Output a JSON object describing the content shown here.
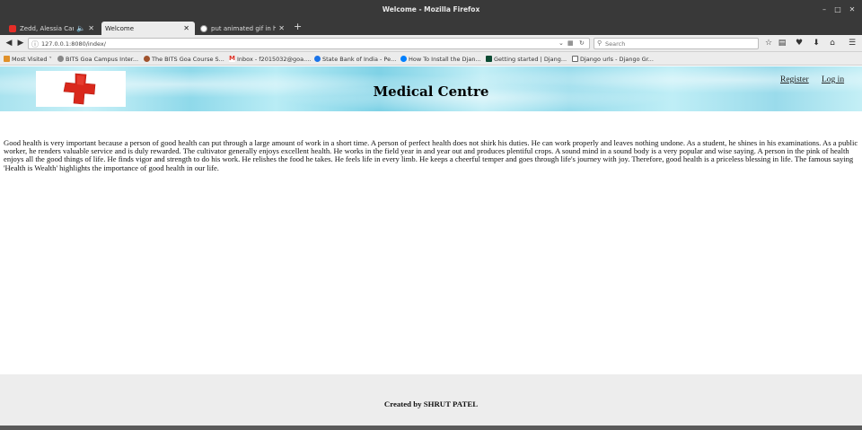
{
  "window": {
    "title": "Welcome - Mozilla Firefox",
    "controls": [
      "minimize",
      "maximize",
      "close"
    ]
  },
  "tabs": [
    {
      "label": "Zedd, Alessia Cara -",
      "icon": "youtube-icon",
      "audio": true,
      "active": false
    },
    {
      "label": "Welcome",
      "icon": "",
      "active": true
    },
    {
      "label": "put animated gif in html",
      "icon": "google-icon",
      "active": false
    }
  ],
  "navbar": {
    "url_host": "127.0.0.1",
    "url_rest": ":8080/index/",
    "search_placeholder": "Search"
  },
  "bookmarks": [
    {
      "label": "Most Visited",
      "icon": "folder-icon",
      "color": "#e0902a"
    },
    {
      "label": "BITS Goa Campus Inter...",
      "icon": "globe-icon",
      "color": "#888888"
    },
    {
      "label": "The BITS Goa Course S...",
      "icon": "site-icon",
      "color": "#a0522d"
    },
    {
      "label": "Inbox - f2015032@goa....",
      "icon": "gmail-icon",
      "color": "#d93025"
    },
    {
      "label": "State Bank of India - Pe...",
      "icon": "sbi-icon",
      "color": "#1a73e8"
    },
    {
      "label": "How To Install the Djan...",
      "icon": "do-icon",
      "color": "#0080ff"
    },
    {
      "label": "Getting started | Djang...",
      "icon": "django-icon",
      "color": "#0c4b33"
    },
    {
      "label": "Django urls - Django Gr...",
      "icon": "page-icon",
      "color": "#666666"
    }
  ],
  "page": {
    "site_title": "Medical Centre",
    "register_label": "Register",
    "login_label": "Log in",
    "body_text": "Good health is very important because a person of good health can put through a large amount of work in a short time. A person of perfect health does not shirk his duties. He can work properly and leaves nothing undone. As a student, he shines in his examinations. As a public worker, he renders valuable service and is duly rewarded. The cultivator generally enjoys excellent health. He works in the field year in and year out and produces plentiful crops. A sound mind in a sound body is a very popular and wise saying. A person in the pink of health enjoys all the good things of life. He finds vigor and strength to do his work. He relishes the food he takes. He feels life in every limb. He keeps a cheerful temper and goes through life's journey with joy. Therefore, good health is a priceless blessing in life. The famous saying 'Health is Wealth' highlights the importance of good health in our life.",
    "footer_credit": "Created by SHRUT PATEL"
  },
  "colors": {
    "chrome_dark": "#393939",
    "toolbar": "#ececec",
    "header_sky": "#9adbeb",
    "logo_red": "#d9281c",
    "footer_bg": "#ededed"
  }
}
